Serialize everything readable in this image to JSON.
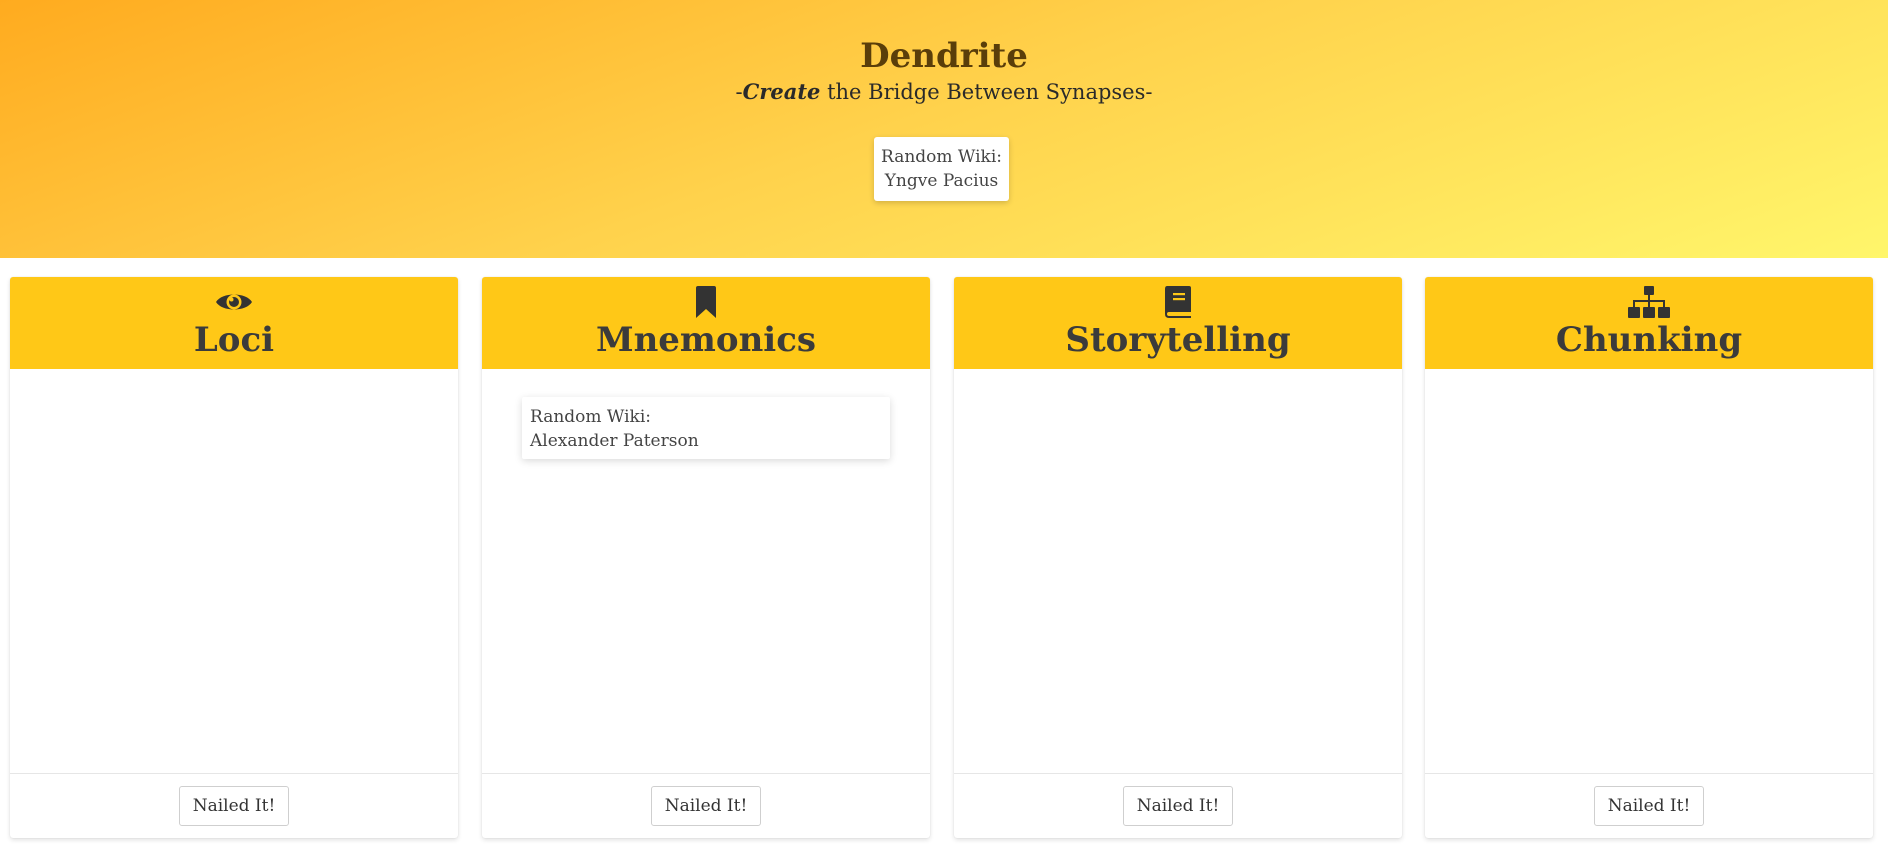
{
  "hero": {
    "title": "Dendrite",
    "subtitle_prefix": "-",
    "subtitle_em": "Create",
    "subtitle_rest": " the Bridge Between Synapses-",
    "random_wiki": {
      "label": "Random Wiki:",
      "value": "Yngve Pacius"
    },
    "gradient_colors": [
      "#ffab1f",
      "#ffd24c",
      "#fff66b"
    ]
  },
  "cards": [
    {
      "title": "Loci",
      "icon": "eye-icon",
      "button_label": "Nailed It!"
    },
    {
      "title": "Mnemonics",
      "icon": "bookmark-icon",
      "button_label": "Nailed It!",
      "note": {
        "label": "Random Wiki:",
        "value": "Alexander Paterson"
      }
    },
    {
      "title": "Storytelling",
      "icon": "book-icon",
      "button_label": "Nailed It!"
    },
    {
      "title": "Chunking",
      "icon": "sitemap-icon",
      "button_label": "Nailed It!"
    }
  ],
  "colors": {
    "card_header": "#ffc817",
    "title_text": "#3b3b3b",
    "hero_title": "#5a3e0a"
  }
}
